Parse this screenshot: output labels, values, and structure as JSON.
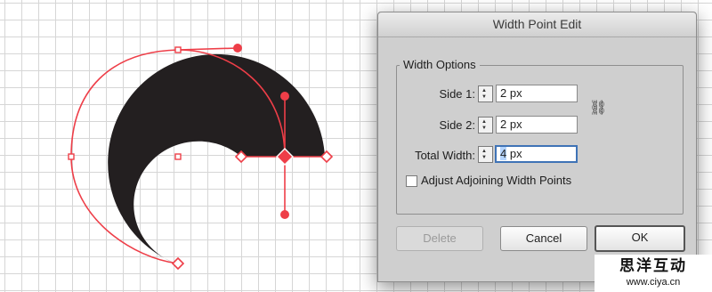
{
  "dialog": {
    "title": "Width Point Edit",
    "group_title": "Width Options",
    "side1": {
      "label": "Side 1:",
      "value": "2 px"
    },
    "side2": {
      "label": "Side 2:",
      "value": "2 px"
    },
    "total": {
      "label": "Total Width:",
      "value_number": "4",
      "value_unit": " px"
    },
    "checkbox": {
      "label": "Adjust Adjoining Width Points",
      "checked": false
    },
    "buttons": {
      "delete": "Delete",
      "cancel": "Cancel",
      "ok": "OK"
    },
    "link_icon": "link-chain-icon"
  },
  "watermark": {
    "line1": "思洋互动",
    "line2": "www.ciya.cn"
  },
  "colors": {
    "stroke_fill": "#231f20",
    "path": "#ee3e48",
    "focus": "#3f73b6",
    "selection": "#b5d5ff"
  }
}
